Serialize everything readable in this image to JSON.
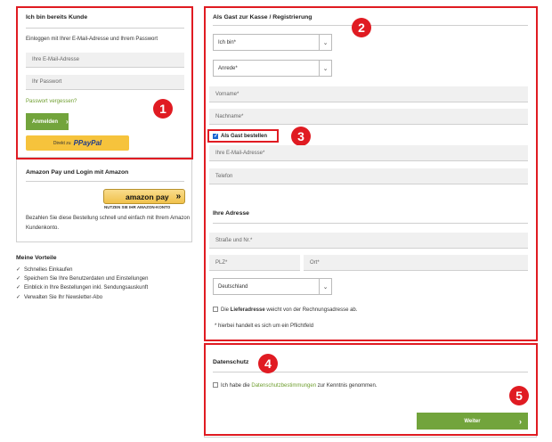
{
  "login": {
    "title": "Ich bin bereits Kunde",
    "intro": "Einloggen mit Ihrer E-Mail-Adresse und Ihrem Passwort",
    "email_placeholder": "Ihre E-Mail-Adresse",
    "password_placeholder": "Ihr Passwort",
    "forgot_link": "Passwort vergessen?",
    "login_button": "Anmelden",
    "paypal_prefix": "Direkt zu",
    "paypal_brand": "PayPal"
  },
  "amazon": {
    "title": "Amazon Pay und Login mit Amazon",
    "button_logo": "amazon pay",
    "button_arrows": "»",
    "button_caption": "NUTZEN SIE IHR AMAZON-KONTO",
    "description_line1": "Bezahlen Sie diese Bestellung schnell und einfach mit Ihrem Amazon",
    "description_line2": "Kundenkonto."
  },
  "benefits": {
    "title": "Meine Vorteile",
    "items": [
      "Schnelles Einkaufen",
      "Speichern Sie Ihre Benutzerdaten und Einstellungen",
      "Einblick in Ihre Bestellungen inkl. Sendungsauskunft",
      "Verwalten Sie Ihr Newsletter-Abo"
    ]
  },
  "guest": {
    "title": "Als Gast zur Kasse / Registrierung",
    "iam_select": "Ich bin*",
    "salutation_select": "Anrede*",
    "firstname_placeholder": "Vorname*",
    "lastname_placeholder": "Nachname*",
    "guest_checkbox_label": "Als Gast bestellen",
    "email_placeholder": "Ihre E-Mail-Adresse*",
    "phone_placeholder": "Telefon",
    "address_title": "Ihre Adresse",
    "street_placeholder": "Straße und Nr.*",
    "zip_placeholder": "PLZ*",
    "city_placeholder": "Ort*",
    "country_select": "Deutschland",
    "billing_prefix": "Die ",
    "billing_bold": "Lieferadresse",
    "billing_suffix": " weicht von der Rechnungsadresse ab.",
    "required_note": "* hierbei handelt es sich um ein Pflichtfeld"
  },
  "privacy": {
    "title": "Datenschutz",
    "consent_prefix": "Ich habe die ",
    "consent_link": "Datenschutzbestimmungen",
    "consent_suffix": " zur Kenntnis genommen.",
    "continue_button": "Weiter",
    "continue_arrow": "›"
  },
  "badges": [
    "1",
    "2",
    "3",
    "4",
    "5"
  ],
  "colors": {
    "accent_red": "#e01b22",
    "button_green": "#72a43c",
    "paypal_yellow": "#f6c33c",
    "checkbox_blue": "#1a66d2"
  }
}
